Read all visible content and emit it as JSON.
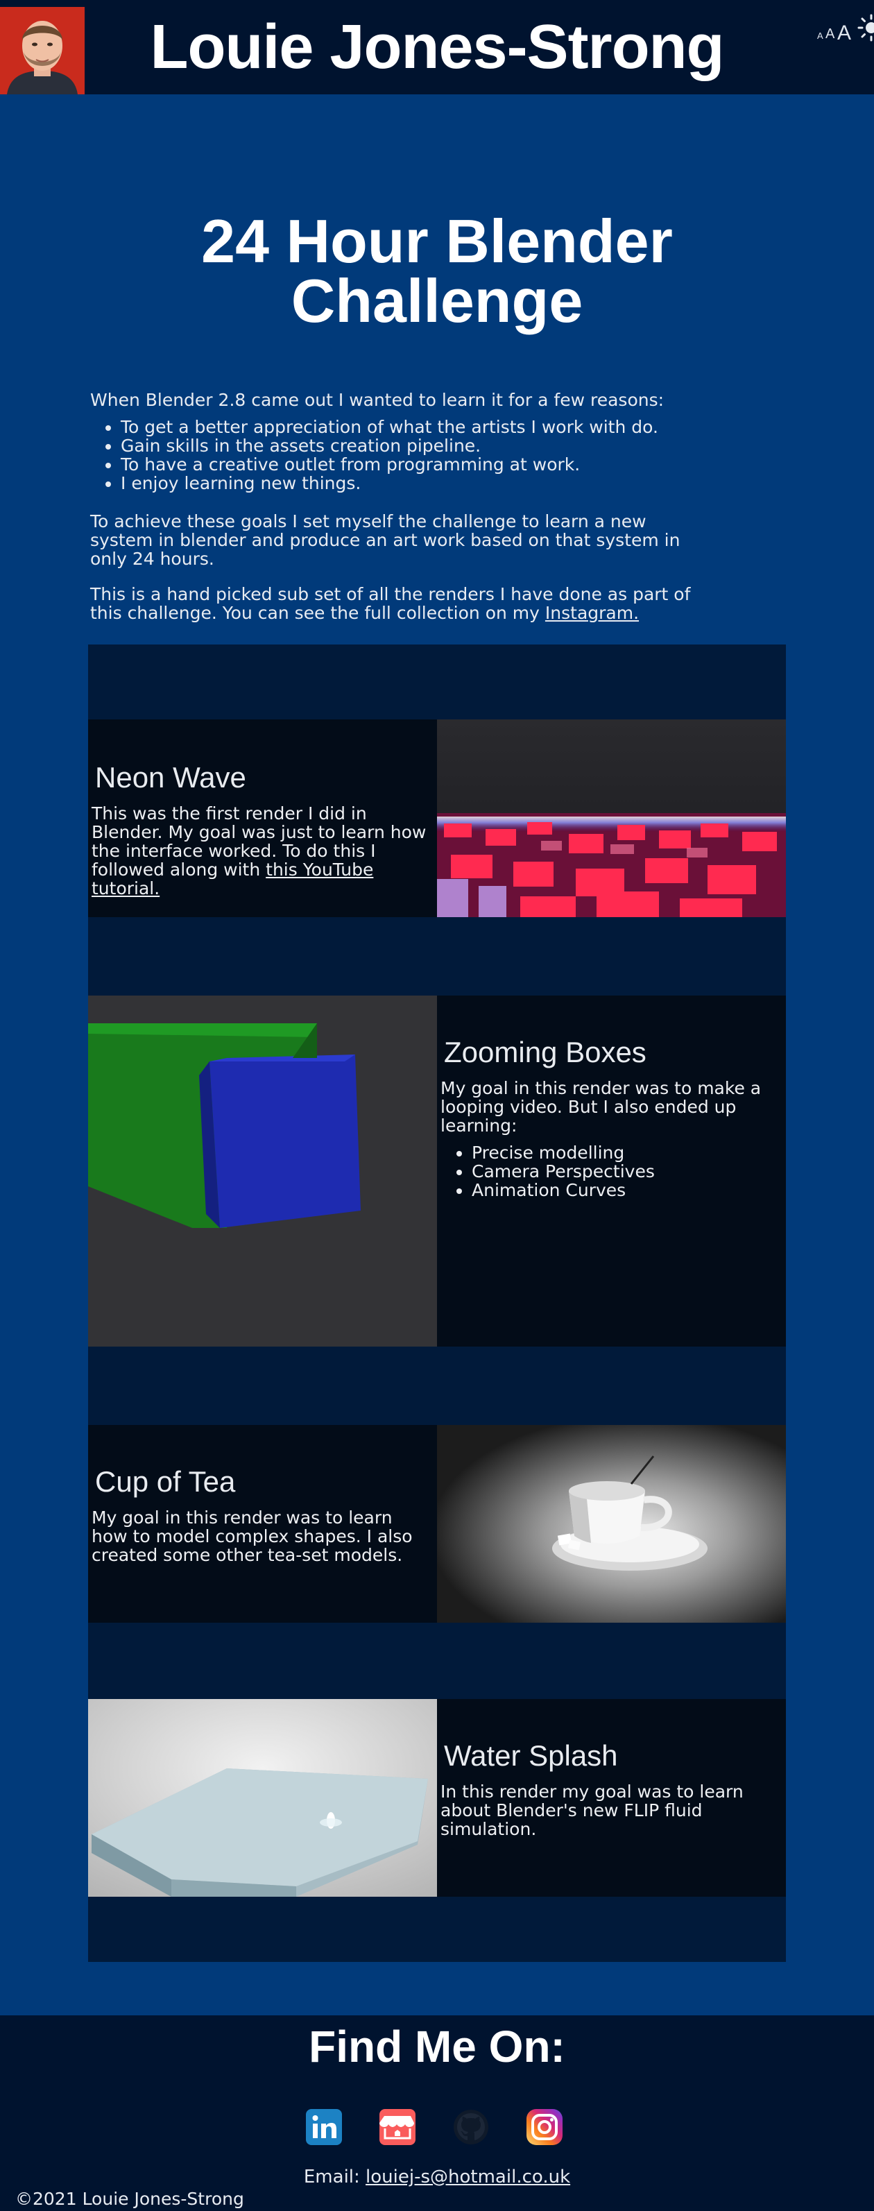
{
  "header": {
    "title": "Louie Jones-Strong",
    "font_small": "A",
    "font_medium": "A",
    "font_large": "A",
    "theme_icon": "sun-icon",
    "avatar_icon": "profile-photo"
  },
  "intro": {
    "page_title": "24 Hour Blender Challenge",
    "lead": "When Blender 2.8 came out I wanted to learn it for a few reasons:",
    "reasons": [
      "To get a better appreciation of what the artists I work with do.",
      "Gain skills in the assets creation pipeline.",
      "To have a creative outlet from programming at work.",
      "I enjoy learning new things."
    ],
    "goal": "To achieve these goals I set myself the challenge to learn a new system in blender and produce an art work based on that system in only 24 hours.",
    "collection_text": "This is a hand picked sub set of all the renders I have done as part of this challenge. You can see the full collection on my ",
    "instagram_link": "Instagram."
  },
  "renders": [
    {
      "title": "Neon Wave",
      "text": "This was the first render I did in Blender. My goal was just to learn how the interface worked. To do this I followed along with ",
      "link": "this YouTube tutorial."
    },
    {
      "title": "Zooming Boxes",
      "text": "My goal in this render was to make a looping video. But I also ended up learning:",
      "items": [
        "Precise modelling",
        "Camera Perspectives",
        "Animation Curves"
      ]
    },
    {
      "title": "Cup of Tea",
      "text": "My goal in this render was to learn how to model complex shapes. I also created some other tea-set models."
    },
    {
      "title": "Water Splash",
      "text": "In this render my goal was to learn about Blender's new FLIP fluid simulation."
    }
  ],
  "footer": {
    "find_title": "Find Me On:",
    "socials": [
      "linkedin-icon",
      "itch-io-icon",
      "github-icon",
      "instagram-icon"
    ],
    "email_label": "Email: ",
    "email": "louiej-s@hotmail.co.uk",
    "copyright": "©2021 Louie Jones-Strong"
  },
  "colors": {
    "page_bg": "#013a7a",
    "header_bg": "#00132f",
    "gallery_bg": "#011a3a",
    "panel_bg": "#030c18"
  }
}
